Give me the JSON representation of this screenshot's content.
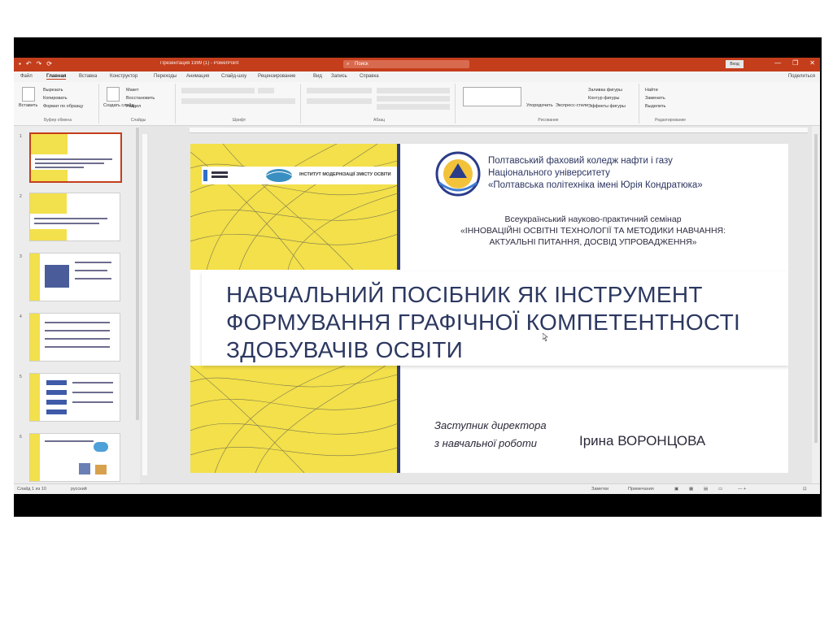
{
  "window": {
    "quick_access": [
      "↶",
      "↷",
      "⟳"
    ],
    "doc_title": "Презентация 1999 (1) - PowerPoint",
    "search_placeholder": "Поиск",
    "login_label": "Вход",
    "controls": [
      "—",
      "❐",
      "✕"
    ]
  },
  "ribbon_tabs": [
    "Файл",
    "Главная",
    "Вставка",
    "Конструктор",
    "Переходы",
    "Анимация",
    "Слайд-шоу",
    "Рецензирование",
    "Вид",
    "Запись",
    "Справка"
  ],
  "share_label": "Поделиться",
  "ribbon": {
    "clipboard": {
      "label": "Буфер обмена",
      "paste": "Вставить",
      "cut": "Вырезать",
      "copy": "Копировать",
      "format": "Формат по образцу"
    },
    "slides": {
      "label": "Слайды",
      "new": "Создать слайд",
      "layout": "Макет",
      "reset": "Восстановить",
      "section": "Раздел"
    },
    "font": {
      "label": "Шрифт"
    },
    "paragraph": {
      "label": "Абзац"
    },
    "drawing": {
      "label": "Рисование",
      "arrange": "Упорядочить",
      "styles": "Экспресс-стили",
      "fill": "Заливка фигуры",
      "outline": "Контур фигуры",
      "effects": "Эффекты фигуры"
    },
    "editing": {
      "label": "Редактирование",
      "find": "Найти",
      "replace": "Заменить",
      "select": "Выделить"
    }
  },
  "thumbnails": [
    {
      "num": "1"
    },
    {
      "num": "2"
    },
    {
      "num": "3"
    },
    {
      "num": "4"
    },
    {
      "num": "5"
    },
    {
      "num": "6"
    }
  ],
  "slide": {
    "institute_label": "ІНСТИТУТ МОДЕРНІЗАЦІЇ ЗМІСТУ ОСВІТИ",
    "college_lines": [
      "Полтавський фаховий коледж нафти і газу",
      "Національного університету",
      "«Полтавська політехніка імені Юрія Кондратюка»"
    ],
    "seminar_lines": [
      "Всеукраїнський науково-практичний семінар",
      "«ІННОВАЦІЙНІ ОСВІТНІ ТЕХНОЛОГІЇ ТА МЕТОДИКИ НАВЧАННЯ:",
      "АКТУАЛЬНІ ПИТАННЯ, ДОСВІД УПРОВАДЖЕННЯ»"
    ],
    "title_lines": [
      "НАВЧАЛЬНИЙ ПОСІБНИК ЯК ІНСТРУМЕНТ",
      "ФОРМУВАННЯ ГРАФІЧНОЇ КОМПЕТЕНТНОСТІ",
      "ЗДОБУВАЧІВ ОСВІТИ"
    ],
    "deputy_lines": [
      "Заступник директора",
      "з навчальної роботи"
    ],
    "presenter": "Ірина ВОРОНЦОВА"
  },
  "status_bar": {
    "slide_info": "Слайд 1 из 10",
    "language": "русский",
    "notes": "Заметки",
    "comments": "Примечания",
    "zoom": "—   +"
  },
  "colors": {
    "accent": "#c43e1c",
    "slide_yellow": "#f3e04a",
    "slide_navy": "#2d3c72",
    "title_text": "#2c3860"
  }
}
